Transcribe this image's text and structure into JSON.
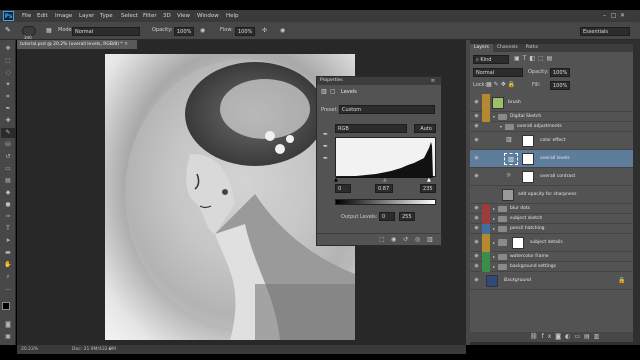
{
  "menu": [
    "File",
    "Edit",
    "Image",
    "Layer",
    "Type",
    "Select",
    "Filter",
    "3D",
    "View",
    "Window",
    "Help"
  ],
  "options": {
    "size_value": "340",
    "mode_label": "Mode:",
    "mode_value": "Normal",
    "opacity_label": "Opacity:",
    "opacity_value": "100%",
    "flow_label": "Flow:",
    "flow_value": "100%",
    "workspace": "Essentials"
  },
  "document": {
    "tab_title": "tutorial.psd @ 20.2% (overall levels, RGB/8) *",
    "zoom": "20.23%",
    "doc_size": "Doc: 21.9M/432.0M"
  },
  "properties": {
    "panel_title": "Properties",
    "section": "Levels",
    "preset_label": "Preset:",
    "preset_value": "Custom",
    "channel": "RGB",
    "auto_label": "Auto",
    "input_levels": [
      "0",
      "0.87",
      "235"
    ],
    "output_label": "Output Levels:",
    "output_levels": [
      "0",
      "255"
    ]
  },
  "layers_panel": {
    "tabs": [
      "Layers",
      "Channels",
      "Paths"
    ],
    "kind_label": "Kind",
    "blend_mode": "Normal",
    "opacity_label": "Opacity:",
    "opacity_value": "100%",
    "lock_label": "Lock:",
    "fill_label": "Fill:",
    "fill_value": "100%",
    "layers": [
      {
        "name": "brush",
        "color": "#b58a2e"
      },
      {
        "name": "Digital Sketch",
        "color": "#b58a2e"
      },
      {
        "name": "overall adjustments",
        "color": ""
      },
      {
        "name": "color effect",
        "color": ""
      },
      {
        "name": "overall levels",
        "color": ""
      },
      {
        "name": "overall contrast",
        "color": ""
      },
      {
        "name": "add opacity for sharpness",
        "color": ""
      },
      {
        "name": "blur dots",
        "color": "#9c3b3b"
      },
      {
        "name": "subject sketch",
        "color": "#9c3b3b"
      },
      {
        "name": "pencil hatching",
        "color": "#3f6f9e"
      },
      {
        "name": "subject details",
        "color": "#b58a2e"
      },
      {
        "name": "watercolor frame",
        "color": "#3c8c4a"
      },
      {
        "name": "background settings",
        "color": "#3c8c4a"
      },
      {
        "name": "Background",
        "color": ""
      }
    ]
  }
}
